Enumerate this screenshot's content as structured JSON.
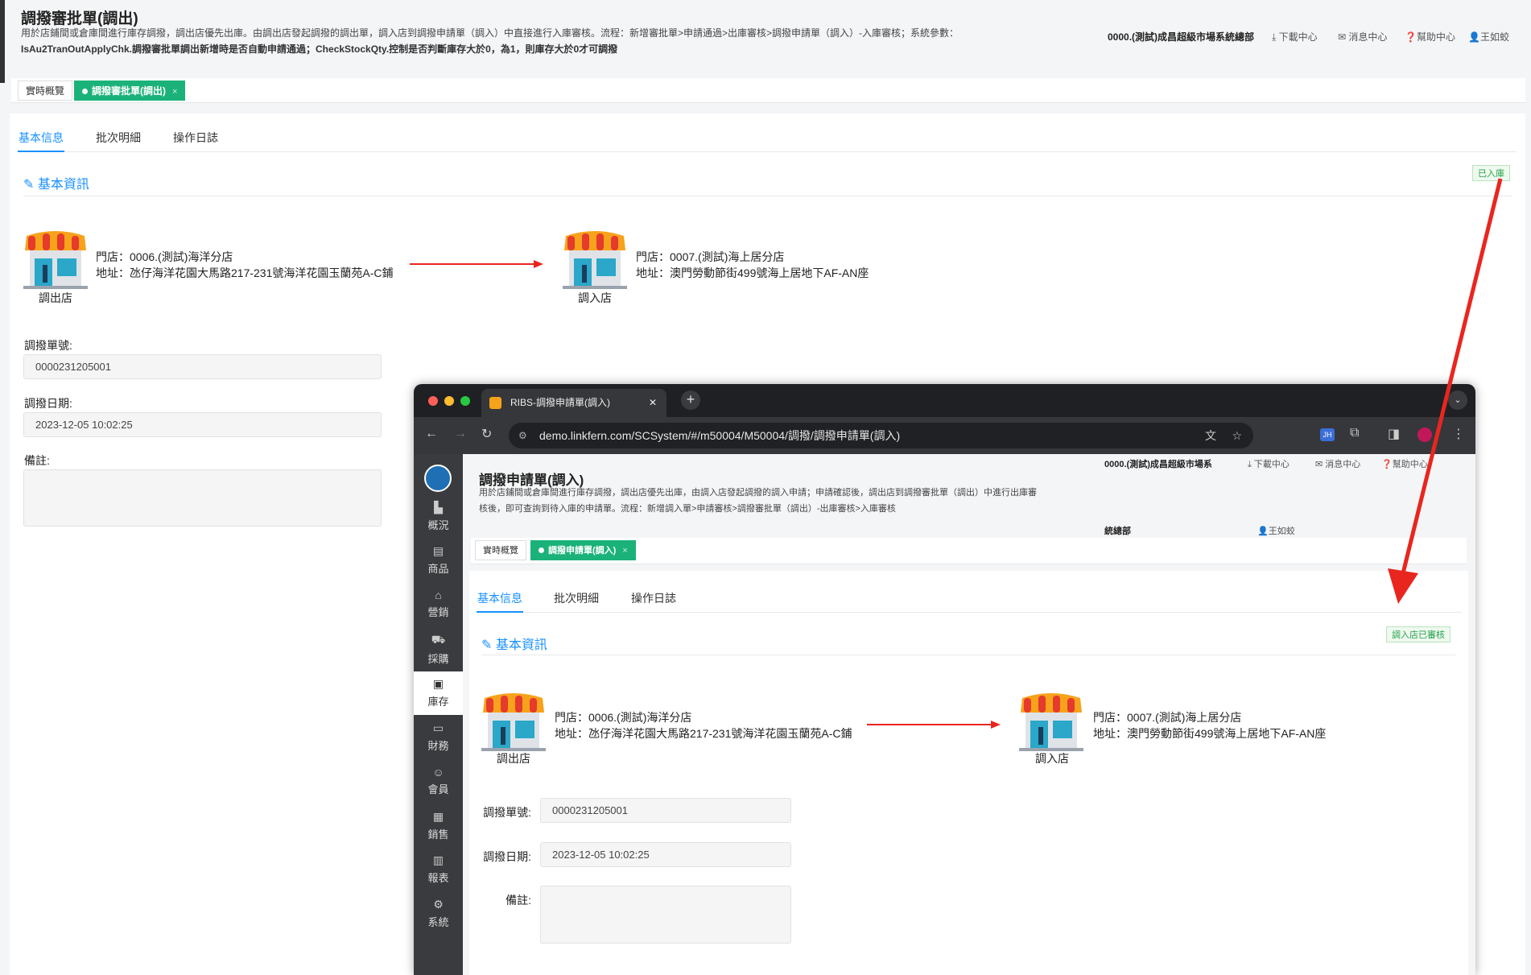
{
  "page": {
    "title": "調撥審批單(調出)",
    "desc1": "用於店鋪間或倉庫間進行庫存調撥，調出店優先出庫。由調出店發起調撥的調出單，調入店到調撥申請單（調入）中直接進行入庫審核。流程：新增審批單>申請通過>出庫審核>調撥申請單（調入）-入庫審核；系統參數：",
    "desc2": "IsAu2TranOutApplyChk.調撥審批單調出新增時是否自動申請通過；CheckStockQty.控制是否判斷庫存大於0，為1，則庫存大於0才可調撥",
    "header": {
      "org": "0000.(測試)成昌超級市場系統總部",
      "download": "下載中心",
      "message": "消息中心",
      "help": "幫助中心",
      "user": "王如蛟"
    },
    "tabs": [
      {
        "label": "實時概覽"
      },
      {
        "label": "調撥審批單(調出)"
      }
    ],
    "inner_tabs": [
      "基本信息",
      "批次明細",
      "操作日誌"
    ],
    "section": "基本資訊",
    "status": "已入庫",
    "out_store": {
      "store": "門店：0006.(測試)海洋分店",
      "address": "地址：氹仔海洋花園大馬路217-231號海洋花園玉蘭苑A-C鋪",
      "label": "調出店"
    },
    "in_store": {
      "store": "門店：0007.(測試)海上居分店",
      "address": "地址：澳門勞動節街499號海上居地下AF-AN座",
      "label": "調入店"
    },
    "form": {
      "no_label": "調撥單號:",
      "no": "0000231205001",
      "date_label": "調撥日期:",
      "date": "2023-12-05 10:02:25",
      "remark_label": "備註:",
      "remark": ""
    }
  },
  "browser": {
    "tab_title": "RIBS-調撥申請單(調入)",
    "url": "demo.linkfern.com/SCSystem/#/m50004/M50004/調撥/調撥申請單(調入)",
    "sidebar": [
      "概況",
      "商品",
      "營銷",
      "採購",
      "庫存",
      "財務",
      "會員",
      "銷售",
      "報表",
      "系統"
    ],
    "page": {
      "title": "調撥申請單(調入)",
      "desc1": "用於店鋪間或倉庫間進行庫存調撥，調出店優先出庫，由調入店發起調撥的調入申請；申請確認後，調出店到調撥審批單（調出）中進行出庫審",
      "desc2": "核後，即可查詢到待入庫的申請單。流程：新增調入單>申請審核>調撥審批單（調出）-出庫審核>入庫審核",
      "header": {
        "org": "0000.(測試)成昌超級市場系",
        "org2": "統總部",
        "download": "下載中心",
        "message": "消息中心",
        "help": "幫助中心",
        "user": "王如蛟"
      },
      "tabs": [
        {
          "label": "實時概覽"
        },
        {
          "label": "調撥申請單(調入)"
        }
      ],
      "inner_tabs": [
        "基本信息",
        "批次明細",
        "操作日誌"
      ],
      "section": "基本資訊",
      "status": "調入店已審核",
      "out_store": {
        "store": "門店：0006.(測試)海洋分店",
        "address": "地址：氹仔海洋花園大馬路217-231號海洋花園玉蘭苑A-C鋪",
        "label": "調出店"
      },
      "in_store": {
        "store": "門店：0007.(測試)海上居分店",
        "address": "地址：澳門勞動節街499號海上居地下AF-AN座",
        "label": "調入店"
      },
      "form": {
        "no_label": "調撥單號:",
        "no": "0000231205001",
        "date_label": "調撥日期:",
        "date": "2023-12-05 10:02:25",
        "remark_label": "備註:",
        "remark": ""
      }
    }
  },
  "colors": {
    "accent": "#1890ff",
    "tab_active": "#1bb27a",
    "arrow": "#e8261f"
  }
}
